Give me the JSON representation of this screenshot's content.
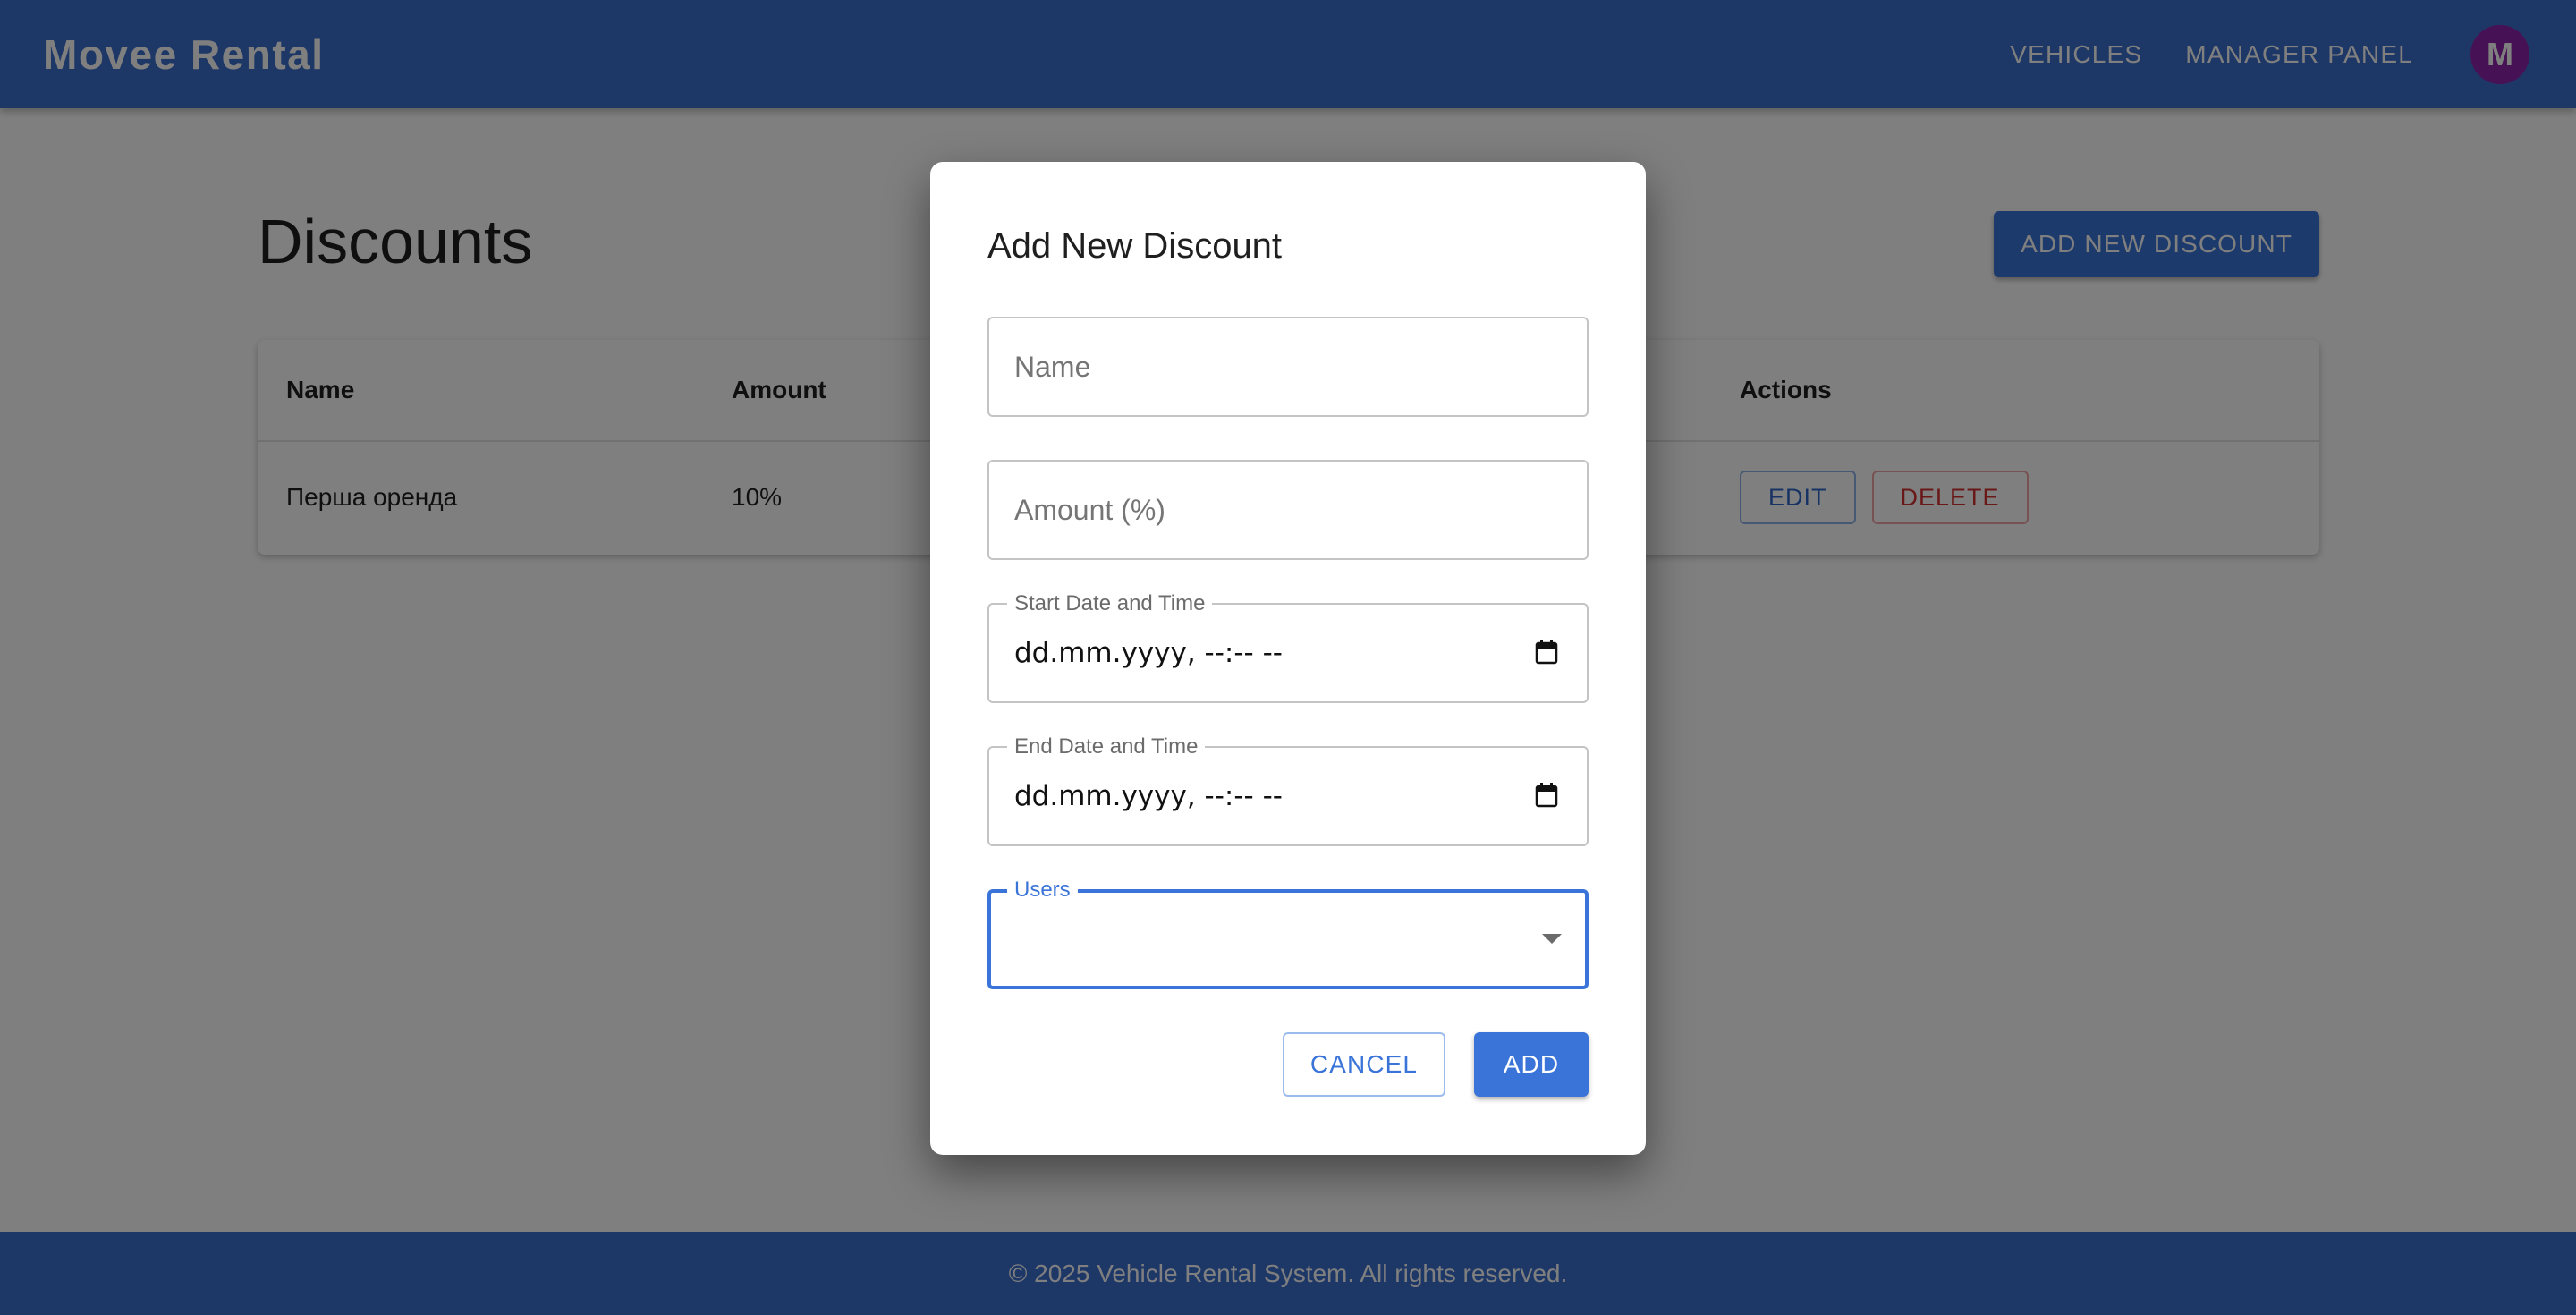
{
  "header": {
    "brand": "Movee Rental",
    "nav": [
      "VEHICLES",
      "MANAGER PANEL"
    ],
    "avatar_initial": "M",
    "avatar_color": "#8e24aa",
    "bar_color": "#3a6fcf"
  },
  "main": {
    "title": "Discounts",
    "add_button_label": "ADD NEW DISCOUNT",
    "table": {
      "columns": [
        "Name",
        "Amount",
        "Actions"
      ],
      "rows": [
        {
          "name": "Перша оренда",
          "amount": "10%",
          "edit_label": "EDIT",
          "delete_label": "DELETE"
        }
      ]
    }
  },
  "dialog": {
    "title": "Add New Discount",
    "name_placeholder": "Name",
    "amount_placeholder": "Amount (%)",
    "start_label": "Start Date and Time",
    "start_value": "dd.mm.yyyy, --:-- --",
    "end_label": "End Date and Time",
    "end_value": "dd.mm.yyyy, --:-- --",
    "users_label": "Users",
    "users_value": "",
    "cancel_label": "CANCEL",
    "add_label": "ADD",
    "accent_color": "#3a74d8"
  },
  "footer": {
    "text": "© 2025 Vehicle Rental System. All rights reserved."
  }
}
